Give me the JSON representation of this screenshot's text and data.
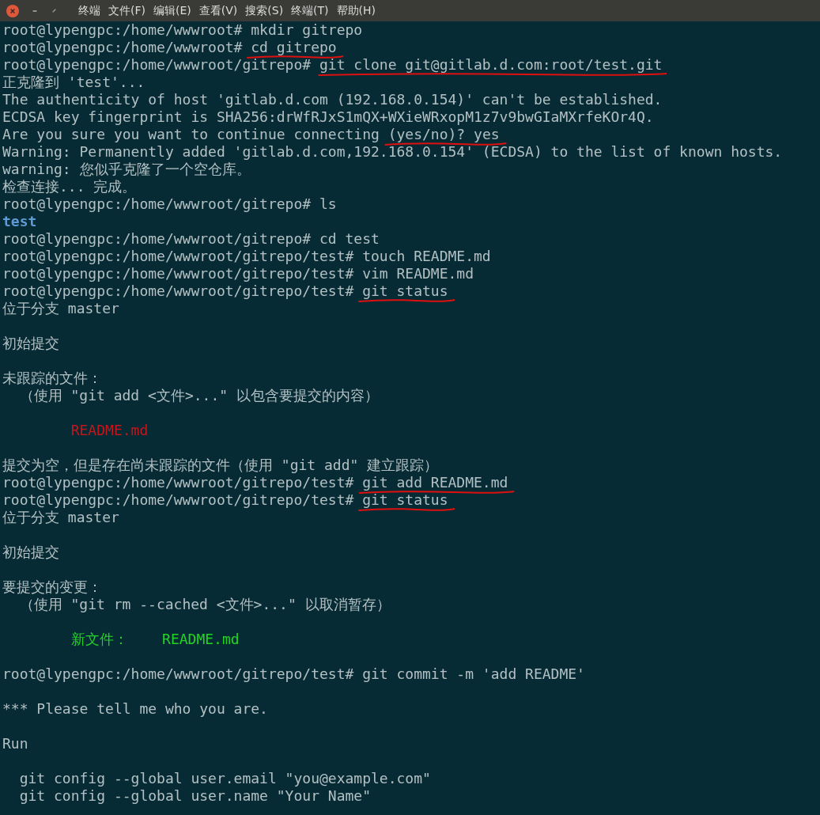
{
  "window": {
    "menu": [
      {
        "label": "终端"
      },
      {
        "label": "文件(F)"
      },
      {
        "label": "编辑(E)"
      },
      {
        "label": "查看(V)"
      },
      {
        "label": "搜索(S)"
      },
      {
        "label": "终端(T)"
      },
      {
        "label": "帮助(H)"
      }
    ]
  },
  "lines": [
    {
      "kind": "prompt",
      "text": "root@lypengpc:/home/wwwroot# ",
      "tail": "mkdir gitrepo",
      "underlined": false
    },
    {
      "kind": "prompt",
      "text": "root@lypengpc:/home/wwwroot# ",
      "tail": "cd gitrepo",
      "underlined": true
    },
    {
      "kind": "prompt",
      "text": "root@lypengpc:/home/wwwroot/gitrepo# ",
      "tail": "git clone git@gitlab.d.com:root/test.git",
      "underlined": true
    },
    {
      "kind": "output",
      "text": "正克隆到 'test'..."
    },
    {
      "kind": "output",
      "text": "The authenticity of host 'gitlab.d.com (192.168.0.154)' can't be established."
    },
    {
      "kind": "output",
      "text": "ECDSA key fingerprint is SHA256:drWfRJxS1mQX+WXieWRxopM1z7v9bwGIaMXrfeKOr4Q."
    },
    {
      "kind": "output",
      "text": "Are you sure you want to continue connecting ",
      "tail": "(yes/no)? yes",
      "underlined": true
    },
    {
      "kind": "output",
      "text": "Warning: Permanently added 'gitlab.d.com,192.168.0.154' (ECDSA) to the list of known hosts."
    },
    {
      "kind": "output",
      "text": "warning: 您似乎克隆了一个空仓库。"
    },
    {
      "kind": "output",
      "text": "检查连接... 完成。"
    },
    {
      "kind": "prompt",
      "text": "root@lypengpc:/home/wwwroot/gitrepo# ",
      "tail": "ls",
      "underlined": false
    },
    {
      "kind": "directory",
      "text": "test"
    },
    {
      "kind": "prompt",
      "text": "root@lypengpc:/home/wwwroot/gitrepo# ",
      "tail": "cd test",
      "underlined": false
    },
    {
      "kind": "prompt",
      "text": "root@lypengpc:/home/wwwroot/gitrepo/test# ",
      "tail": "touch README.md",
      "underlined": false
    },
    {
      "kind": "prompt",
      "text": "root@lypengpc:/home/wwwroot/gitrepo/test# ",
      "tail": "vim README.md",
      "underlined": false
    },
    {
      "kind": "prompt",
      "text": "root@lypengpc:/home/wwwroot/gitrepo/test# ",
      "tail": "git status",
      "underlined": true
    },
    {
      "kind": "output",
      "text": "位于分支 master"
    },
    {
      "kind": "blank"
    },
    {
      "kind": "output",
      "text": "初始提交"
    },
    {
      "kind": "blank"
    },
    {
      "kind": "output",
      "text": "未跟踪的文件："
    },
    {
      "kind": "output",
      "text": "  （使用 \"git add <文件>...\" 以包含要提交的内容）"
    },
    {
      "kind": "blank"
    },
    {
      "kind": "untracked",
      "text": "        README.md"
    },
    {
      "kind": "blank"
    },
    {
      "kind": "output",
      "text": "提交为空，但是存在尚未跟踪的文件（使用 \"git add\" 建立跟踪）"
    },
    {
      "kind": "prompt",
      "text": "root@lypengpc:/home/wwwroot/gitrepo/test# ",
      "tail": "git add README.md",
      "underlined": true
    },
    {
      "kind": "prompt",
      "text": "root@lypengpc:/home/wwwroot/gitrepo/test# ",
      "tail": "git status",
      "underlined": true
    },
    {
      "kind": "output",
      "text": "位于分支 master"
    },
    {
      "kind": "blank"
    },
    {
      "kind": "output",
      "text": "初始提交"
    },
    {
      "kind": "blank"
    },
    {
      "kind": "output",
      "text": "要提交的变更："
    },
    {
      "kind": "output",
      "text": "  （使用 \"git rm --cached <文件>...\" 以取消暂存）"
    },
    {
      "kind": "blank"
    },
    {
      "kind": "staged",
      "text": "        新文件：    README.md"
    },
    {
      "kind": "blank"
    },
    {
      "kind": "prompt",
      "text": "root@lypengpc:/home/wwwroot/gitrepo/test# ",
      "tail": "git commit -m 'add README'",
      "underlined": false
    },
    {
      "kind": "blank"
    },
    {
      "kind": "output",
      "text": "*** Please tell me who you are."
    },
    {
      "kind": "blank"
    },
    {
      "kind": "output",
      "text": "Run"
    },
    {
      "kind": "blank"
    },
    {
      "kind": "output",
      "text": "  git config --global user.email \"you@example.com\""
    },
    {
      "kind": "output",
      "text": "  git config --global user.name \"Your Name\""
    }
  ]
}
